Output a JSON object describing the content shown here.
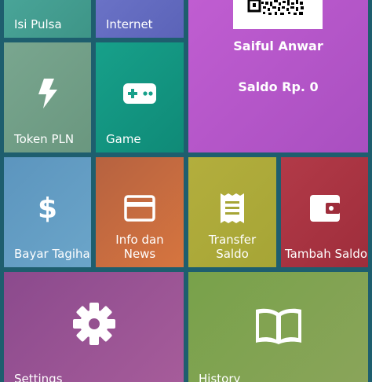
{
  "tiles": {
    "pulsa": {
      "label": "Isi Pulsa"
    },
    "internet": {
      "label": "Internet"
    },
    "token": {
      "label": "Token PLN",
      "icon": "bolt-icon"
    },
    "game": {
      "label": "Game",
      "icon": "gamepad-icon"
    },
    "bayar": {
      "label": "Bayar Tagihan",
      "icon": "dollar-icon"
    },
    "info": {
      "label": "Info dan News",
      "icon": "card-icon"
    },
    "transfer": {
      "label": "Transfer Saldo",
      "icon": "receipt-icon"
    },
    "tambah": {
      "label": "Tambah Saldo",
      "icon": "wallet-icon"
    },
    "settings": {
      "label": "Settings",
      "icon": "gear-icon"
    },
    "history": {
      "label": "History",
      "icon": "book-icon"
    }
  },
  "profile": {
    "name": "Saiful Anwar",
    "saldo": "Saldo Rp. 0",
    "qr_icon": "qr-code-icon"
  }
}
